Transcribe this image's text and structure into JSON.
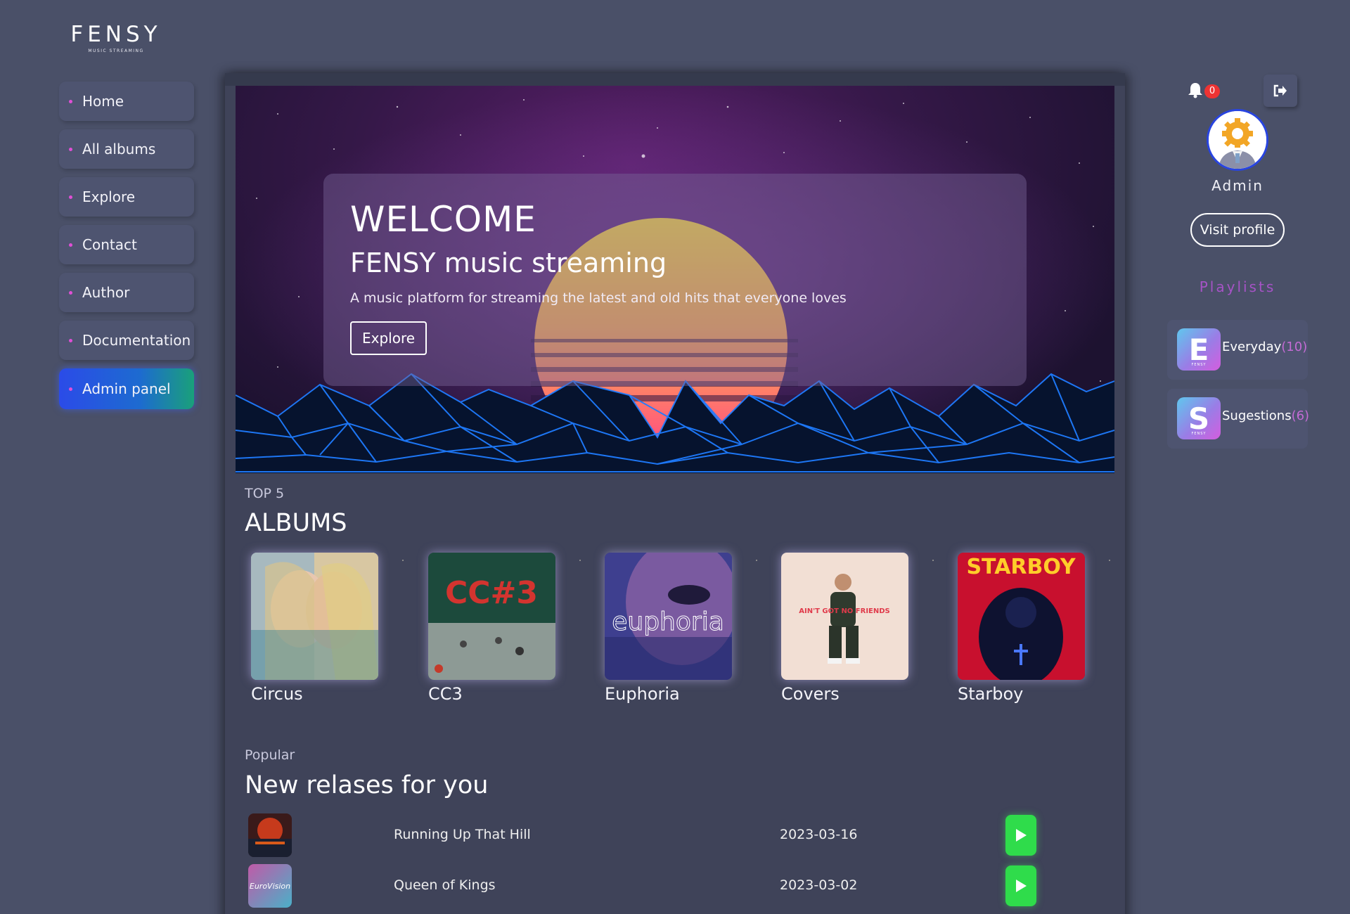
{
  "logo": {
    "main": "FENSY",
    "sub": "MUSIC STREAMING"
  },
  "nav": {
    "items": [
      {
        "label": "Home"
      },
      {
        "label": "All albums"
      },
      {
        "label": "Explore"
      },
      {
        "label": "Contact"
      },
      {
        "label": "Author"
      },
      {
        "label": "Documentation"
      },
      {
        "label": "Admin panel",
        "active": true
      }
    ]
  },
  "hero": {
    "title": "WELCOME",
    "subtitle": "FENSY music streaming",
    "description": "A music platform for streaming the latest and old hits that everyone loves",
    "button": "Explore"
  },
  "albums_section": {
    "kicker": "TOP 5",
    "title": "ALBUMS",
    "albums": [
      {
        "name": "Circus",
        "cover_text": ""
      },
      {
        "name": "CC3",
        "cover_text": "CC#3"
      },
      {
        "name": "Euphoria",
        "cover_text": "euphoria"
      },
      {
        "name": "Covers",
        "cover_text": "AIN'T GOT NO FRIENDS"
      },
      {
        "name": "Starboy",
        "cover_text": "STARBOY"
      }
    ]
  },
  "releases": {
    "kicker": "Popular",
    "title": "New relases for you",
    "rows": [
      {
        "title": "Running Up That Hill",
        "date": "2023-03-16",
        "thumb_icon": "stranger-things-thumb"
      },
      {
        "title": "Queen of Kings",
        "date": "2023-03-02",
        "thumb_icon": "eurovision-thumb",
        "thumb_text": "EuroVision"
      }
    ]
  },
  "user": {
    "notifications": "0",
    "name": "Admin",
    "visit_profile": "Visit profile"
  },
  "playlists": {
    "label": "Playlists",
    "items": [
      {
        "letter": "E",
        "tag": "FENSY",
        "name": "Everyday",
        "count": "(10)"
      },
      {
        "letter": "S",
        "tag": "FENSY",
        "name": "Sugestions",
        "count": "(6)"
      }
    ]
  },
  "colors": {
    "background": "#4a5068",
    "panel": "#3f4359",
    "accent_pink": "#e04fd6",
    "play_green": "#2fdc4b",
    "active_nav_start": "#2b4be8",
    "active_nav_end": "#1aa07a"
  }
}
